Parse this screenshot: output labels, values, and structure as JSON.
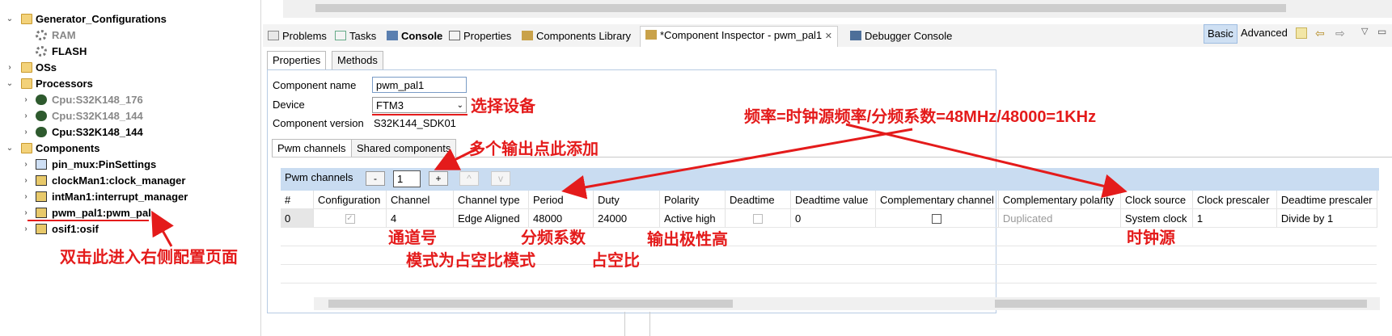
{
  "tree": {
    "items": [
      {
        "label": "Generator_Configurations",
        "twisty": "⌄"
      },
      {
        "label": "RAM"
      },
      {
        "label": "FLASH"
      },
      {
        "label": "OSs",
        "twisty": "›"
      },
      {
        "label": "Processors",
        "twisty": "⌄"
      },
      {
        "label": "Cpu:S32K148_176",
        "twisty": "›"
      },
      {
        "label": "Cpu:S32K148_144",
        "twisty": "›"
      },
      {
        "label": "Cpu:S32K148_144",
        "twisty": "›"
      },
      {
        "label": "Components",
        "twisty": "⌄"
      },
      {
        "label": "pin_mux:PinSettings",
        "twisty": "›"
      },
      {
        "label": "clockMan1:clock_manager",
        "twisty": "›"
      },
      {
        "label": "intMan1:interrupt_manager",
        "twisty": "›"
      },
      {
        "label": "pwm_pal1:pwm_pal",
        "twisty": "›"
      },
      {
        "label": "osif1:osif",
        "twisty": "›"
      }
    ]
  },
  "tabs": [
    "Problems",
    "Tasks",
    "Console",
    "Properties",
    "Components Library",
    "*Component Inspector - pwm_pal1",
    "Debugger Console"
  ],
  "view_modes": {
    "basic": "Basic",
    "advanced": "Advanced"
  },
  "inspector": {
    "subtabs": [
      "Properties",
      "Methods"
    ],
    "component_name_label": "Component name",
    "component_name_value": "pwm_pal1",
    "device_label": "Device",
    "device_value": "FTM3",
    "version_label": "Component version",
    "version_value": "S32K144_SDK01",
    "inner_tabs": [
      "Pwm channels",
      "Shared components"
    ],
    "pwm_channels_label": "Pwm channels",
    "count": "1",
    "btn_minus": "-",
    "btn_plus": "+",
    "btn_up": "^",
    "btn_down": "v"
  },
  "table": {
    "headers": [
      "#",
      "Configuration",
      "Channel",
      "Channel type",
      "Period",
      "Duty",
      "Polarity",
      "Deadtime",
      "Deadtime value",
      "Complementary channel",
      "Complementary polarity",
      "Clock source",
      "Clock prescaler",
      "Deadtime prescaler"
    ],
    "row": [
      "0",
      "",
      "4",
      "Edge Aligned",
      "48000",
      "24000",
      "Active high",
      "",
      "0",
      "",
      "Duplicated",
      "System clock",
      "1",
      "Divide by 1"
    ]
  },
  "annotations": {
    "select_device": "选择设备",
    "add_multi": "多个输出点此添加",
    "freq_formula": "频率=时钟源频率/分频系数=48MHz/48000=1KHz",
    "channel_no": "通道号",
    "mode": "模式为占空比模式",
    "prescaler": "分频系数",
    "duty": "占空比",
    "polarity_high": "输出极性高",
    "clock_src": "时钟源",
    "double_click": "双击此进入右侧配置页面"
  },
  "colors": {
    "annotation": "#e41b1b",
    "table_bar": "#c9dcf1"
  }
}
